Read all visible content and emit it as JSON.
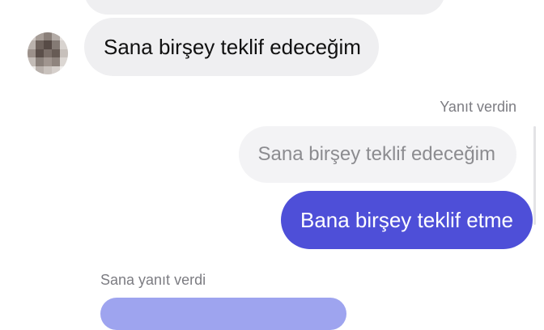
{
  "messages": {
    "received_1": {
      "text": "Sana birşey teklif edeceğim"
    },
    "reply_status": "Yanıt verdin",
    "quoted_text": "Sana birşey teklif edeceğim",
    "sent_1": {
      "text": "Bana birşey teklif etme"
    },
    "reply_status_2": "Sana yanıt verdi"
  },
  "colors": {
    "sent_bubble": "#4e4fd8",
    "received_bubble": "#efeff1",
    "partial_bubble": "#9ea4ef"
  }
}
